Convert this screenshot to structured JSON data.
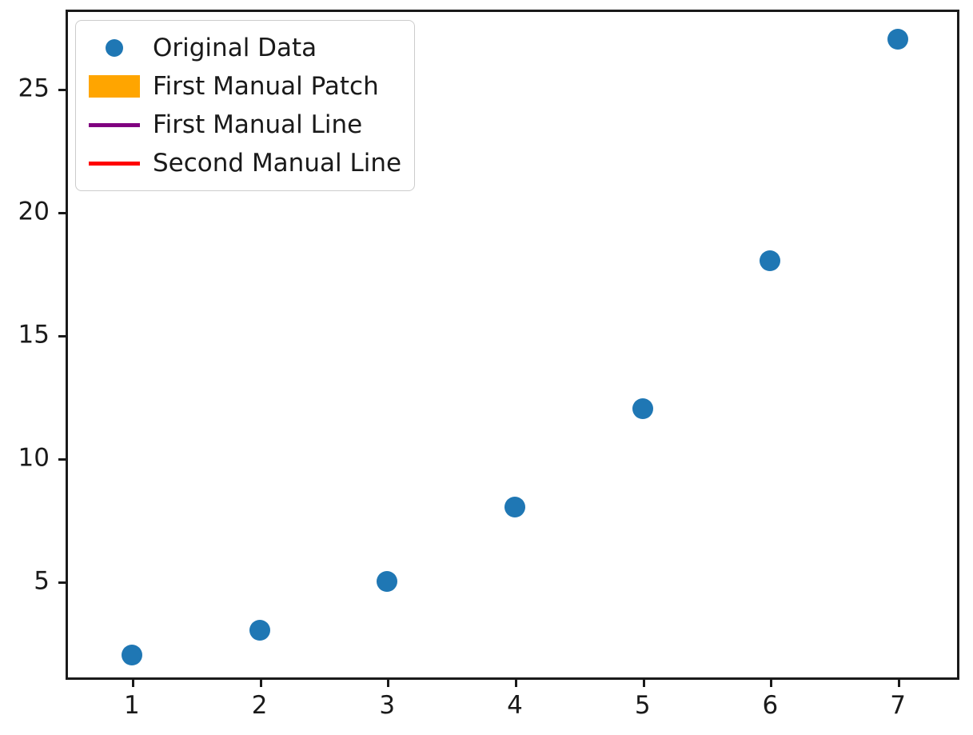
{
  "chart_data": {
    "type": "scatter",
    "title": "",
    "xlabel": "",
    "ylabel": "",
    "x": [
      1,
      2,
      3,
      4,
      5,
      6,
      7
    ],
    "values": [
      2,
      3,
      5,
      8,
      12,
      18,
      27
    ],
    "series": [
      {
        "name": "Original Data",
        "x": [
          1,
          2,
          3,
          4,
          5,
          6,
          7
        ],
        "values": [
          2,
          3,
          5,
          8,
          12,
          18,
          27
        ],
        "color": "#1f77b4",
        "marker": "circle"
      }
    ],
    "xlim": [
      0.5,
      7.5
    ],
    "ylim": [
      0.9,
      28.1
    ],
    "xticks": [
      1,
      2,
      3,
      4,
      5,
      6,
      7
    ],
    "xticklabels": [
      "1",
      "2",
      "3",
      "4",
      "5",
      "6",
      "7"
    ],
    "yticks": [
      5,
      10,
      15,
      20,
      25
    ],
    "yticklabels": [
      "5",
      "10",
      "15",
      "20",
      "25"
    ],
    "grid": false,
    "legend_position": "upper left",
    "legend": [
      {
        "label": "Original Data",
        "key": "marker",
        "color": "#1f77b4"
      },
      {
        "label": "First Manual Patch",
        "key": "patch",
        "color": "#ffa500"
      },
      {
        "label": "First Manual Line",
        "key": "line",
        "color": "#800080"
      },
      {
        "label": "Second Manual Line",
        "key": "line",
        "color": "#ff0000"
      }
    ]
  },
  "colors": {
    "data": "#1f77b4",
    "patch": "#ffa500",
    "line_first": "#800080",
    "line_second": "#ff0000",
    "axis": "#1a1a1a",
    "background": "#ffffff",
    "legend_border": "#cccccc"
  }
}
